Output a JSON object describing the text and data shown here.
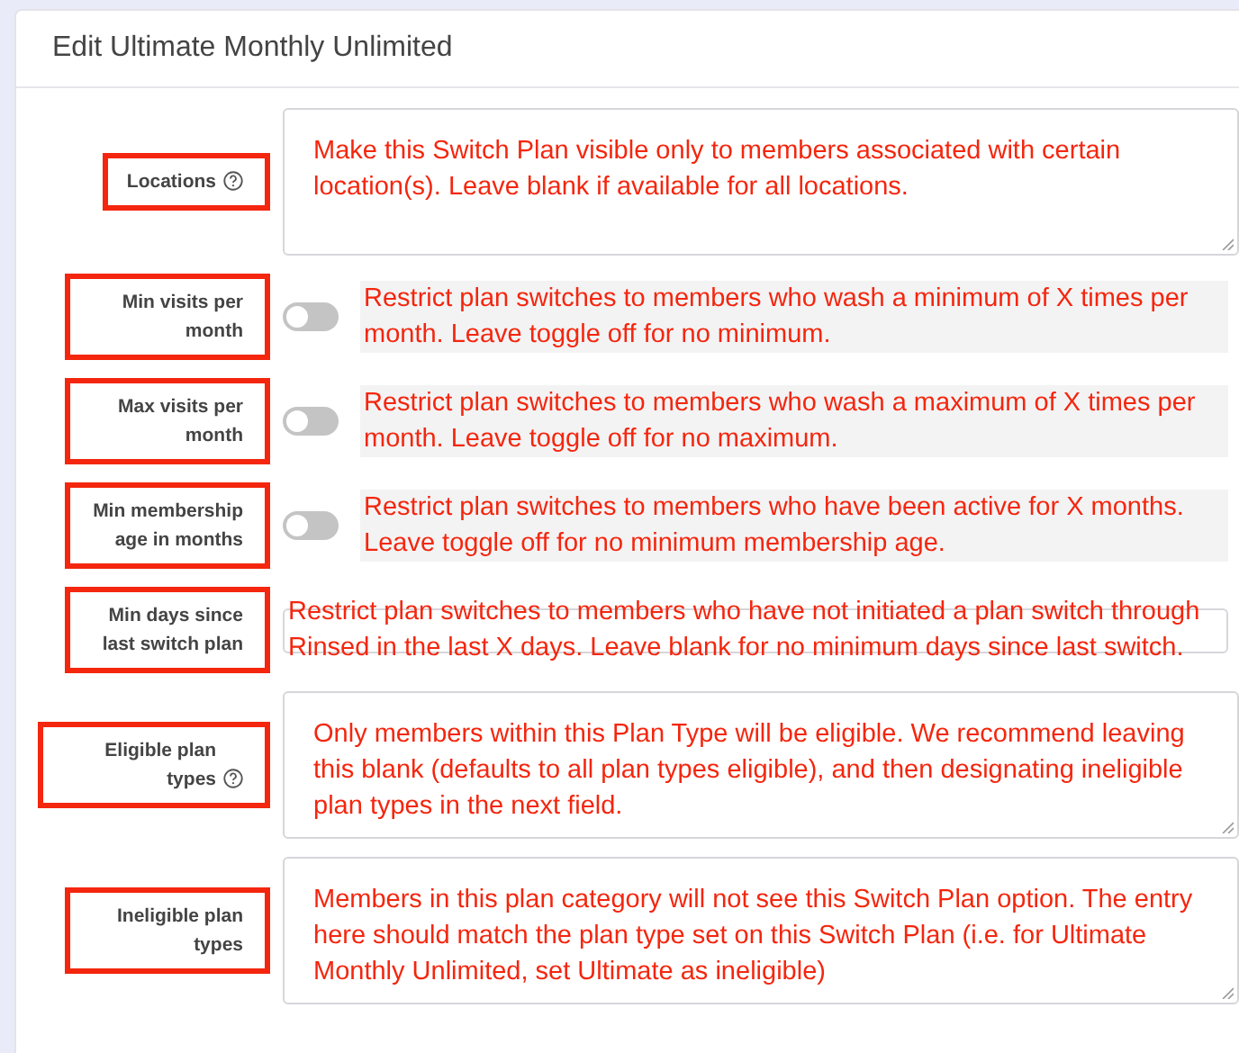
{
  "title": "Edit Ultimate Monthly Unlimited",
  "fields": [
    {
      "kind": "textarea",
      "label": "Locations",
      "help": true,
      "note": "Make this Switch Plan visible only to members associated with certain location(s). Leave blank if available for all locations."
    },
    {
      "kind": "toggle",
      "label": "Min visits per month",
      "help": false,
      "on": false,
      "note": "Restrict plan switches to members who wash a minimum of X times per month. Leave toggle off for no minimum."
    },
    {
      "kind": "toggle",
      "label": "Max visits per month",
      "help": false,
      "on": false,
      "note": "Restrict plan switches to members who wash a maximum of X times per month. Leave toggle off for no maximum."
    },
    {
      "kind": "toggle",
      "label": "Min membership age in months",
      "help": false,
      "on": false,
      "note": "Restrict plan switches to members who have been active for X months. Leave toggle off for no minimum membership age."
    },
    {
      "kind": "input",
      "label": "Min days since last switch plan",
      "help": false,
      "note": "Restrict plan switches to members who have not initiated a plan switch through Rinsed in the last X days. Leave blank for no minimum days since last switch."
    },
    {
      "kind": "textarea",
      "label": "Eligible plan types",
      "help": true,
      "note": "Only members within this Plan Type will be eligible. We recommend leaving this blank (defaults to all plan types eligible), and then designating ineligible plan types in the next field."
    },
    {
      "kind": "textarea",
      "label": "Ineligible plan types",
      "help": false,
      "note": "Members in this plan category will not see this Switch Plan option. The entry here should match the plan type set on this Switch Plan (i.e. for Ultimate Monthly Unlimited, set Ultimate as ineligible)"
    }
  ]
}
